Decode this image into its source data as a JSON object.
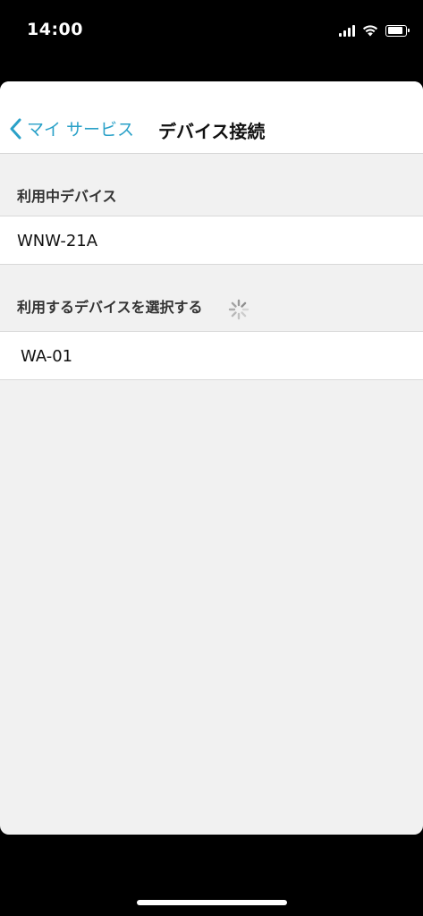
{
  "status_bar": {
    "time": "14:00",
    "battery_level": 0.85,
    "icons": [
      "signal-icon",
      "wifi-icon",
      "battery-icon"
    ]
  },
  "nav": {
    "back_label": "マイ サービス",
    "title": "デバイス接続",
    "accent_color": "#2aa1c8"
  },
  "sections": {
    "current_device": {
      "header": "利用中デバイス",
      "item": "WNW-21A"
    },
    "select_device": {
      "header": "利用するデバイスを選択する",
      "item": "WA-01"
    }
  }
}
